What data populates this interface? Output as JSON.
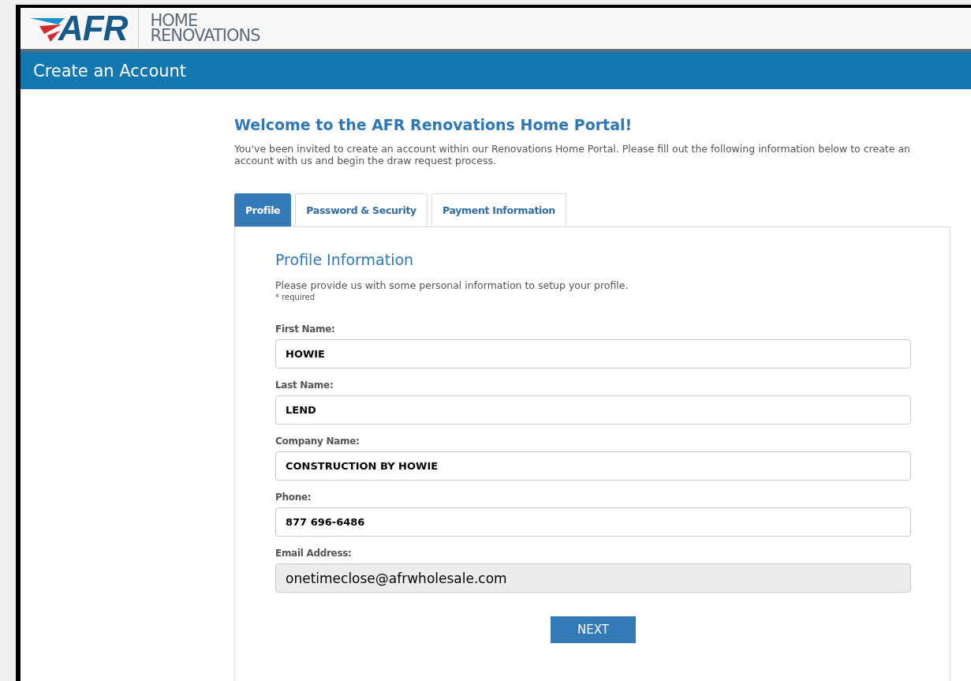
{
  "logo": {
    "brand": "AFR",
    "line_1": "HOME",
    "line_2": "RENOVATIONS"
  },
  "page_title": "Create an Account",
  "welcome": {
    "heading": "Welcome to the AFR Renovations Home Portal!",
    "intro": "You've been invited to create an account within our Renovations Home Portal. Please fill out the following information below to create an account with us and begin the draw request process."
  },
  "tabs": [
    {
      "label": "Profile",
      "selected": true
    },
    {
      "label": "Password & Security",
      "selected": false
    },
    {
      "label": "Payment Information",
      "selected": false
    }
  ],
  "section": {
    "heading": "Profile Information",
    "description": "Please provide us with some personal information to setup your profile.",
    "note": "* required"
  },
  "fields": [
    {
      "label": "First Name:",
      "value": "HOWIE",
      "disabled": false
    },
    {
      "label": "Last Name:",
      "value": "LEND",
      "disabled": false
    },
    {
      "label": "Company Name:",
      "value": "CONSTRUCTION BY HOWIE",
      "disabled": false
    },
    {
      "label": "Phone:",
      "value": "877 696-6486",
      "disabled": false
    },
    {
      "label": "Email Address:",
      "value": "onetimeclose@afrwholesale.com",
      "disabled": true
    }
  ],
  "next_button": "NEXT"
}
